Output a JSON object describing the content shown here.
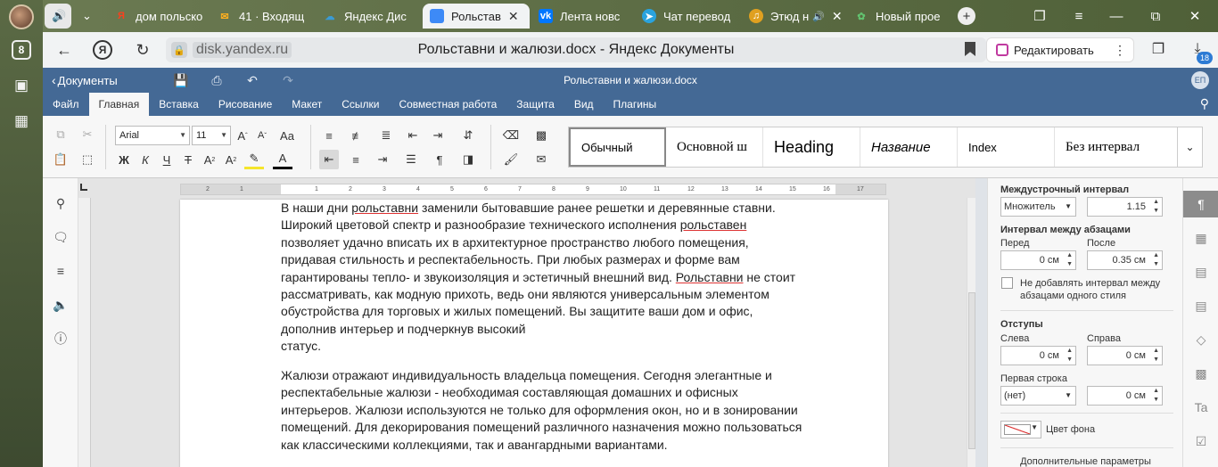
{
  "browser": {
    "left_badge": "8",
    "tabs": [
      {
        "label": "дом польско",
        "icon": "yandex-icon",
        "color": "#fc3f1d"
      },
      {
        "label": "41 · Входящ",
        "icon": "mail-icon",
        "color": "#ff9800"
      },
      {
        "label": "Яндекс Дис",
        "icon": "disk-icon",
        "color": "#3a7bd5"
      },
      {
        "label": "Рольстав",
        "icon": "docs-icon",
        "color": "#3d8af7"
      },
      {
        "label": "Лента новс",
        "icon": "vk-icon",
        "color": "#0077ff"
      },
      {
        "label": "Чат перевод",
        "icon": "telegram-icon",
        "color": "#2aa3de"
      },
      {
        "label": "Этюд н",
        "icon": "music-icon",
        "color": "#e0a020"
      },
      {
        "label": "Новый прое",
        "icon": "leaf-icon",
        "color": "#62c370"
      }
    ],
    "url_host": "disk.yandex.ru",
    "page_title": "Рольставни и жалюзи.docx - Яндекс Документы",
    "edit_button": "Редактировать",
    "downloads_badge": "18"
  },
  "editor": {
    "back_label": "Документы",
    "doc_title": "Рольставни и жалюзи.docx",
    "user_initials": "ЕП",
    "menu_tabs": [
      "Файл",
      "Главная",
      "Вставка",
      "Рисование",
      "Макет",
      "Ссылки",
      "Совместная работа",
      "Защита",
      "Вид",
      "Плагины"
    ],
    "active_tab": "Главная",
    "font_name": "Arial",
    "font_size": "11",
    "styles": [
      "Обычный",
      "Основной ш",
      "Heading",
      "Название",
      "Index",
      "Без интервал"
    ],
    "ruler_numbers": [
      "2",
      "1",
      "1",
      "2",
      "3",
      "4",
      "5",
      "6",
      "7",
      "8",
      "9",
      "10",
      "11",
      "12",
      "13",
      "14",
      "15",
      "16",
      "17"
    ]
  },
  "document": {
    "para1": [
      {
        "t": "В наши дни "
      },
      {
        "t": "рольставни",
        "err": true
      },
      {
        "t": "  заменили бытовавшие ранее решетки и деревянные ставни."
      },
      {
        "br": true
      },
      {
        "t": "Широкий цветовой спектр и  разнообразие технического исполнения "
      },
      {
        "t": "рольставен",
        "err": true
      },
      {
        "br": true
      },
      {
        "t": "позволяет  удачно вписать их в архитектурное пространство любого помещения,"
      },
      {
        "br": true
      },
      {
        "t": "придавая стильность и респектабельность. При любых размерах и форме вам"
      },
      {
        "br": true
      },
      {
        "t": "гарантированы тепло- и звукоизоляция и эстетичный внешний вид. "
      },
      {
        "t": "Рольставни",
        "err": true
      },
      {
        "t": " не стоит"
      },
      {
        "br": true
      },
      {
        "t": "рассматривать, как модную прихоть, ведь они являются универсальным элементом"
      },
      {
        "br": true
      },
      {
        "t": "обустройства для торговых и жилых помещений.  Вы защитите ваши дом и офис,"
      },
      {
        "br": true
      },
      {
        "t": "дополнив интерьер и подчеркнув  высокий"
      },
      {
        "br": true
      },
      {
        "t": "статус."
      }
    ],
    "para2": [
      {
        "t": " Жалюзи отражают индивидуальность владельца помещения. Сегодня элегантные и"
      },
      {
        "br": true
      },
      {
        "t": "респектабельные жалюзи -  необходимая составляющая домашних и офисных"
      },
      {
        "br": true
      },
      {
        "t": "интерьеров.  Жалюзи используются не только для оформления окон, но и в зонировании"
      },
      {
        "br": true
      },
      {
        "t": "помещений.  Для декорирования помещений различного назначения можно пользоваться"
      },
      {
        "br": true
      },
      {
        "t": "как классическими коллекциями, так и авангардными вариантами."
      }
    ]
  },
  "panel": {
    "line_spacing_title": "Междустрочный интервал",
    "line_spacing_type": "Множитель",
    "line_spacing_value": "1.15",
    "para_spacing_title": "Интервал между абзацами",
    "before_label": "Перед",
    "after_label": "После",
    "before_value": "0 см",
    "after_value": "0.35 см",
    "no_space_checkbox": "Не добавлять интервал между абзацами одного стиля",
    "indents_title": "Отступы",
    "left_label": "Слева",
    "right_label": "Справа",
    "left_value": "0 см",
    "right_value": "0 см",
    "first_line_label": "Первая строка",
    "first_line_type": "(нет)",
    "first_line_value": "0 см",
    "bg_color_label": "Цвет фона",
    "more_params": "Дополнительные параметры"
  }
}
